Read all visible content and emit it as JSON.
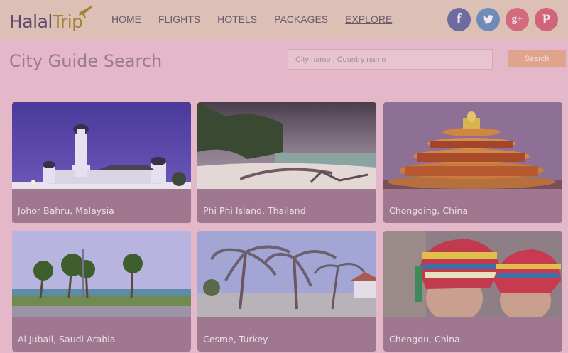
{
  "logo": {
    "part1": "Halal",
    "part2": "Trip",
    "icon": "plane-icon"
  },
  "nav": [
    {
      "label": "HOME",
      "active": false
    },
    {
      "label": "FLIGHTS",
      "active": false
    },
    {
      "label": "HOTELS",
      "active": false
    },
    {
      "label": "PACKAGES",
      "active": false
    },
    {
      "label": "EXPLORE",
      "active": true
    }
  ],
  "social": [
    {
      "icon": "facebook-icon",
      "glyph": "f",
      "color": "#6e6ba0"
    },
    {
      "icon": "twitter-icon",
      "glyph": "t",
      "color": "#6f8cb9"
    },
    {
      "icon": "google-plus-icon",
      "glyph": "g+",
      "color": "#d36b7c"
    },
    {
      "icon": "pinterest-icon",
      "glyph": "P",
      "color": "#d1647a"
    }
  ],
  "search": {
    "title": "City Guide Search",
    "placeholder": "City name , Country name",
    "button_label": "Search"
  },
  "cities": [
    {
      "label": "Johor Bahru, Malaysia"
    },
    {
      "label": "Phi Phi Island, Thailand"
    },
    {
      "label": "Chongqing, China"
    },
    {
      "label": "Al Jubail, Saudi Arabia"
    },
    {
      "label": "Cesme, Turkey"
    },
    {
      "label": "Chengdu, China"
    }
  ],
  "colors": {
    "page_bg": "#e4b8c9",
    "header_bg": "#dcc0b6",
    "search_button": "#e0a38c",
    "card_bg": "#9f7890"
  }
}
